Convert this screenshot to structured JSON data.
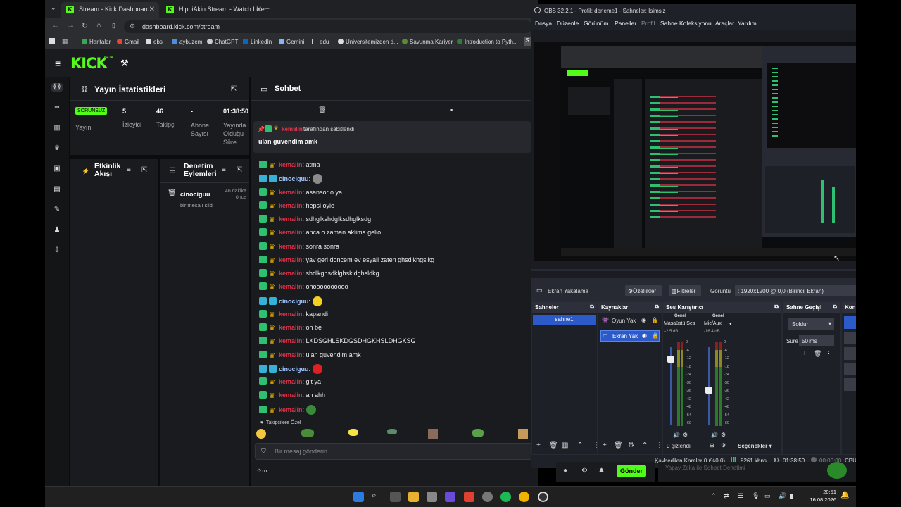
{
  "browser": {
    "tabs": [
      {
        "title": "Stream - Kick Dashboard",
        "active": true
      },
      {
        "title": "HippiAkin Stream - Watch Live",
        "active": false
      }
    ],
    "new_tab": "+",
    "url": "dashboard.kick.com/stream",
    "bookmarks": [
      "Haritalar",
      "Gmail",
      "obs",
      "aybuzem",
      "ChatGPT",
      "LinkedIn",
      "Gemini",
      "edu",
      "Üniversitemizden d...",
      "Savunma Kariyer",
      "Introduction to Pyth..."
    ]
  },
  "kick": {
    "logo": "KICK",
    "logo_beta": "BETA",
    "stats": {
      "title": "Yayın İstatistikleri",
      "status_badge": "SORUNSUZ",
      "status_label": "Yayın",
      "viewers_value": "5",
      "viewers_label": "İzleyici",
      "followers_value": "46",
      "followers_label": "Takipçi",
      "subs_value": "-",
      "subs_label": "Abone Sayısı",
      "uptime_value": "01:38:50",
      "uptime_label": "Yayında Olduğu Süre"
    },
    "activity": {
      "title": "Etkinlik Akışı"
    },
    "moderation": {
      "title": "Denetim Eylemleri",
      "entry_user": "cinociguu",
      "entry_time": "46 dakika önce",
      "entry_action": "bir mesajı sildi"
    },
    "chat": {
      "title": "Sohbet",
      "pinned_by_user": "kemalin",
      "pinned_suffix": "tarafından sabitlendi",
      "pinned_text": "ulan guvendim amk",
      "messages": [
        {
          "user": "kemalin",
          "text": ": atma"
        },
        {
          "user": "cinociguu",
          "text": ":"
        },
        {
          "user": "kemalin",
          "text": ": asansor o ya"
        },
        {
          "user": "kemalin",
          "text": ": hepsi oyle"
        },
        {
          "user": "kemalin",
          "text": ": sdhglkshdglksdhglksdg"
        },
        {
          "user": "kemalin",
          "text": ": anca o zaman aklima gelio"
        },
        {
          "user": "kemalin",
          "text": ": sonra sonra"
        },
        {
          "user": "kemalin",
          "text": ": yav geri doncem ev esyali zaten ghsdlkhgslkg"
        },
        {
          "user": "kemalin",
          "text": ": shdlkghsdklghskldghsldkg"
        },
        {
          "user": "kemalin",
          "text": ": ohoooooooooo"
        },
        {
          "user": "cinociguu",
          "text": ":"
        },
        {
          "user": "kemalin",
          "text": ": kapandi"
        },
        {
          "user": "kemalin",
          "text": ": oh be"
        },
        {
          "user": "kemalin",
          "text": ": LKDSGHLSKDGSDHGKHSLDHGKSG"
        },
        {
          "user": "kemalin",
          "text": ": ulan guvendim amk"
        },
        {
          "user": "cinociguu",
          "text": ":"
        },
        {
          "user": "kemalin",
          "text": ": git ya"
        },
        {
          "user": "kemalin",
          "text": ": ah ahh"
        },
        {
          "user": "kemalin",
          "text": ":"
        }
      ],
      "emote_label": "Takipçilere Özel",
      "input_placeholder": "Bir mesaj gönderin",
      "send_button": "Gönder",
      "ai_hint": "Yapay Zeka ile Sohbet Denetimi"
    }
  },
  "obs": {
    "title": "OBS 32.2.1 - Profil: deneme1 - Sahneler: İsimsiz",
    "menu": [
      "Dosya",
      "Düzenle",
      "Görünüm",
      "Paneller",
      "Profil",
      "Sahne Koleksiyonu",
      "Araçlar",
      "Yardım"
    ],
    "source_bar": {
      "source_name": "Ekran Yakalama",
      "properties": "Özellikler",
      "filters": "Filtreler",
      "display_label": "Görüntü",
      "display_value": ": 1920x1200 @ 0,0 (Birincil Ekran)"
    },
    "scenes": {
      "title": "Sahneler",
      "items": [
        "sahne1"
      ]
    },
    "sources": {
      "title": "Kaynaklar",
      "items": [
        "Oyun Yak",
        "Ekran Yak"
      ]
    },
    "mixer": {
      "title": "Ses Karıştırıcı",
      "channels": [
        {
          "group": "Genel",
          "name": "Masaüstü Ses",
          "db": "-2.5 dB"
        },
        {
          "group": "Genel",
          "name": "Mic/Aux",
          "db": "-16.4 dB"
        }
      ],
      "scale": [
        "0",
        "-6",
        "-12",
        "-18",
        "-24",
        "-30",
        "-36",
        "-42",
        "-48",
        "-54",
        "-60"
      ],
      "hidden_label": "0 gizlendi",
      "options": "Seçenekler"
    },
    "transitions": {
      "title": "Sahne Geçişl",
      "type": "Soldur",
      "duration_label": "Süre",
      "duration_value": "50 ms"
    },
    "controls_title": "Kon",
    "statusbar": {
      "dropped": "Kaybedilen Kareler 0 (%0.0)",
      "bitrate": "8261 kbps",
      "live_time": "01:38:59",
      "rec_time": "00:00:00",
      "cpu": "CPU"
    }
  },
  "taskbar": {
    "time": "20:51",
    "date": "16.08.2026"
  },
  "colors": {
    "kick_green": "#53fc18",
    "username_red": "#e0324a",
    "obs_selected": "#2c5ac8"
  }
}
